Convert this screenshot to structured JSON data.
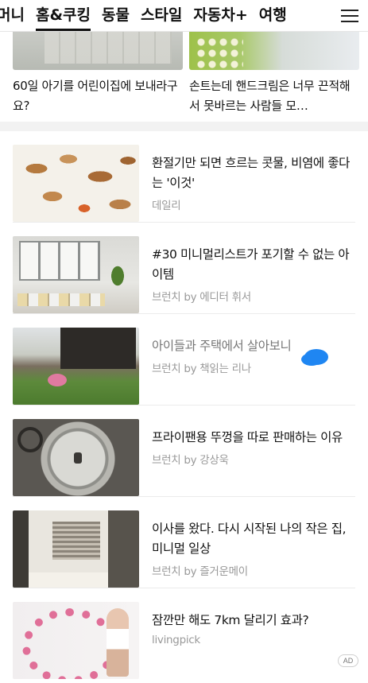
{
  "nav": {
    "tabs": [
      {
        "label": "머니",
        "active": false
      },
      {
        "label": "홈&쿠킹",
        "active": true
      },
      {
        "label": "동물",
        "active": false
      },
      {
        "label": "스타일",
        "active": false
      },
      {
        "label": "자동차+",
        "active": false
      },
      {
        "label": "여행",
        "active": false
      }
    ],
    "menu_icon": "hamburger-menu-icon"
  },
  "featured": [
    {
      "title": "60일 아기를 어린이집에 보내라구요?"
    },
    {
      "title": "손트는데 핸드크림은 너무 끈적해서 못바르는 사람들 모…"
    }
  ],
  "articles": [
    {
      "title": "환절기만 되면 흐르는 콧물, 비염에 좋다는 '이것'",
      "source": "데일리",
      "thumb": "dried-leaves"
    },
    {
      "title": "#30 미니멀리스트가 포기할 수 없는 아이템",
      "source": "브런치 by 에디터 휘서",
      "thumb": "minimal-room"
    },
    {
      "title": "아이들과 주택에서 살아보니",
      "source": "브런치 by 책읽는 리나",
      "thumb": "house-garden"
    },
    {
      "title": "프라이팬용 뚜껑을 따로 판매하는 이유",
      "source": "브런치 by 강상욱",
      "thumb": "pan-lid"
    },
    {
      "title": "이사를 왔다. 다시 시작된 나의 작은 집, 미니멀 일상",
      "source": "브런치 by 즐거운메이",
      "thumb": "empty-room-window"
    },
    {
      "title": "잠깐만 해도 7km 달리기 효과?",
      "source": "livingpick",
      "thumb": "hula-hoop",
      "badge": "AD"
    }
  ],
  "colors": {
    "accent_blob": "#1f86f2",
    "divider": "#f2f2f2"
  }
}
